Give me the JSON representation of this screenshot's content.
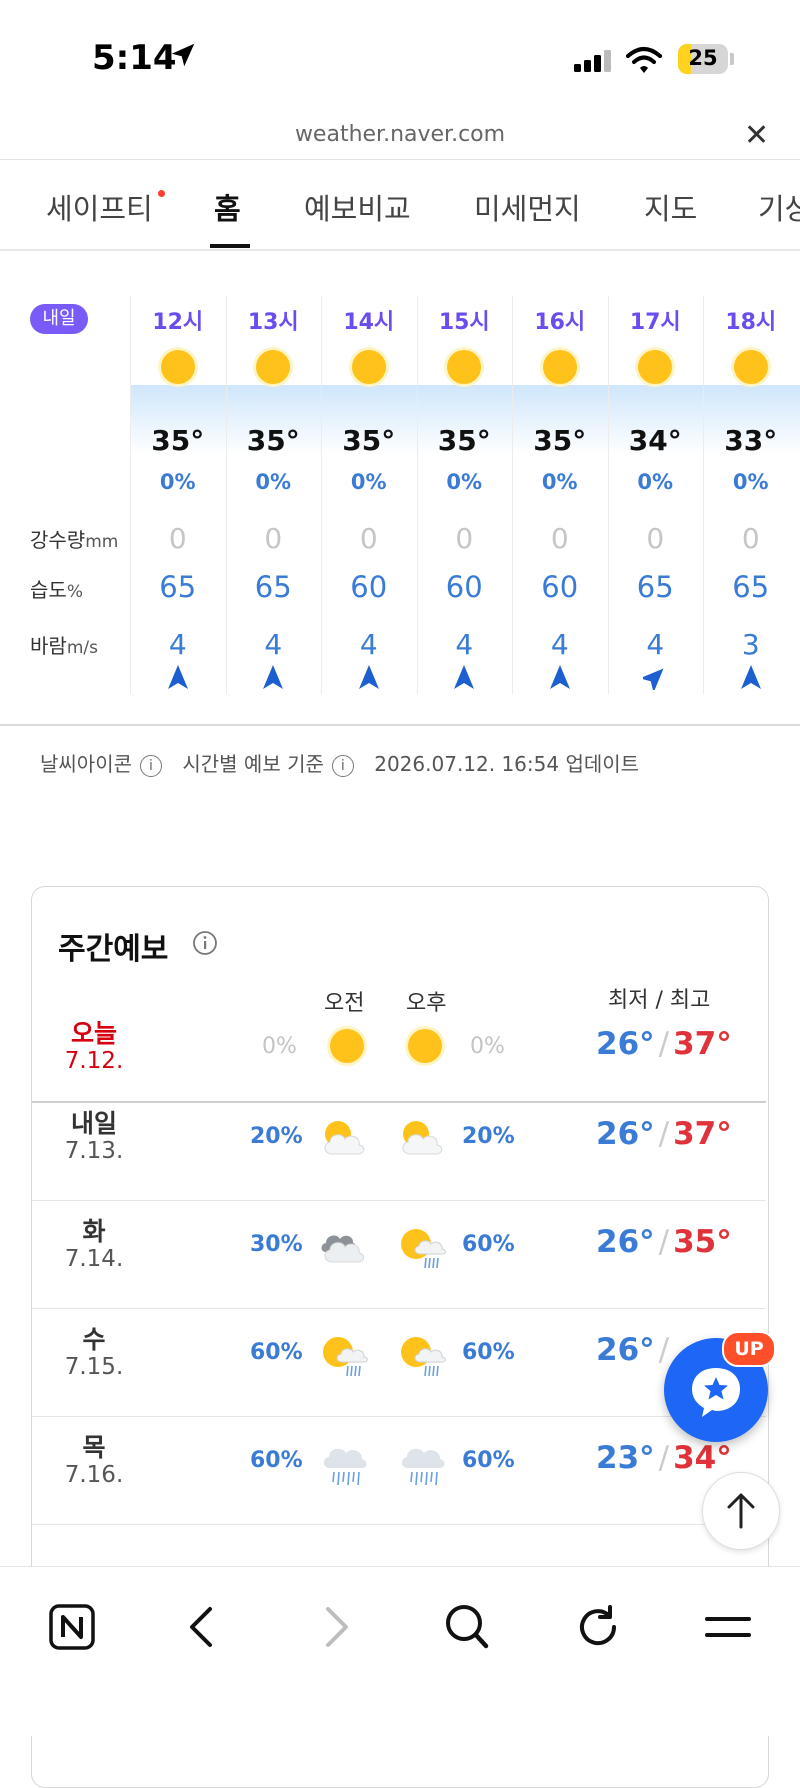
{
  "status_bar": {
    "time": "5:14",
    "battery": "25",
    "battery_level": 0.25
  },
  "browser": {
    "url": "weather.naver.com"
  },
  "tabs": [
    {
      "label": "세이프티",
      "dot": true
    },
    {
      "label": "홈",
      "active": true
    },
    {
      "label": "예보비교"
    },
    {
      "label": "미세먼지"
    },
    {
      "label": "지도"
    },
    {
      "label": "기상"
    }
  ],
  "hourly": {
    "badge": "내일",
    "labels": {
      "precip": "강수량",
      "precip_unit": "mm",
      "humidity": "습도",
      "humidity_unit": "%",
      "wind": "바람",
      "wind_unit": "m/s"
    },
    "hours": [
      {
        "hour": "12시",
        "icon": "sun-icon",
        "temp": "35°",
        "pop": "0%",
        "precip": "0",
        "humidity": "65",
        "wind": "4",
        "wind_dir": "north"
      },
      {
        "hour": "13시",
        "icon": "sun-icon",
        "temp": "35°",
        "pop": "0%",
        "precip": "0",
        "humidity": "65",
        "wind": "4",
        "wind_dir": "north"
      },
      {
        "hour": "14시",
        "icon": "sun-icon",
        "temp": "35°",
        "pop": "0%",
        "precip": "0",
        "humidity": "60",
        "wind": "4",
        "wind_dir": "north"
      },
      {
        "hour": "15시",
        "icon": "sun-icon",
        "temp": "35°",
        "pop": "0%",
        "precip": "0",
        "humidity": "60",
        "wind": "4",
        "wind_dir": "north"
      },
      {
        "hour": "16시",
        "icon": "sun-icon",
        "temp": "35°",
        "pop": "0%",
        "precip": "0",
        "humidity": "60",
        "wind": "4",
        "wind_dir": "north"
      },
      {
        "hour": "17시",
        "icon": "sun-icon",
        "temp": "34°",
        "pop": "0%",
        "precip": "0",
        "humidity": "65",
        "wind": "4",
        "wind_dir": "northeast"
      },
      {
        "hour": "18시",
        "icon": "sun-icon",
        "temp": "33°",
        "pop": "0%",
        "precip": "0",
        "humidity": "65",
        "wind": "3",
        "wind_dir": "north"
      }
    ],
    "footer": {
      "weather_icon_label": "날씨아이콘",
      "basis_label": "시간별 예보 기준",
      "updated": "2026.07.12. 16:54 업데이트"
    }
  },
  "weekly": {
    "title": "주간예보",
    "am_label": "오전",
    "pm_label": "오후",
    "minmax_label": "최저 / 최고",
    "days": [
      {
        "day": "오늘",
        "date": "7.12.",
        "am_pop": "0%",
        "am_icon": "sun-icon",
        "pm_icon": "sun-icon",
        "pm_pop": "0%",
        "min": "26°",
        "max": "37°",
        "today": true
      },
      {
        "day": "내일",
        "date": "7.13.",
        "am_pop": "20%",
        "am_icon": "partly-cloudy-icon",
        "pm_icon": "partly-cloudy-icon",
        "pm_pop": "20%",
        "min": "26°",
        "max": "37°"
      },
      {
        "day": "화",
        "date": "7.14.",
        "am_pop": "30%",
        "am_icon": "cloudy-icon",
        "pm_icon": "sun-rain-icon",
        "pm_pop": "60%",
        "min": "26°",
        "max": "35°"
      },
      {
        "day": "수",
        "date": "7.15.",
        "am_pop": "60%",
        "am_icon": "sun-rain-icon",
        "pm_icon": "sun-rain-icon",
        "pm_pop": "60%",
        "min": "26°",
        "max": ""
      },
      {
        "day": "목",
        "date": "7.16.",
        "am_pop": "60%",
        "am_icon": "rain-icon",
        "pm_icon": "rain-icon",
        "pm_pop": "60%",
        "min": "23°",
        "max": "34°"
      }
    ]
  },
  "floating": {
    "up_badge": "UP"
  },
  "colors": {
    "accent_blue": "#3a7bd5",
    "hot_red": "#e0323a",
    "badge_purple": "#7a5af8",
    "fab_blue": "#1e66f5"
  }
}
